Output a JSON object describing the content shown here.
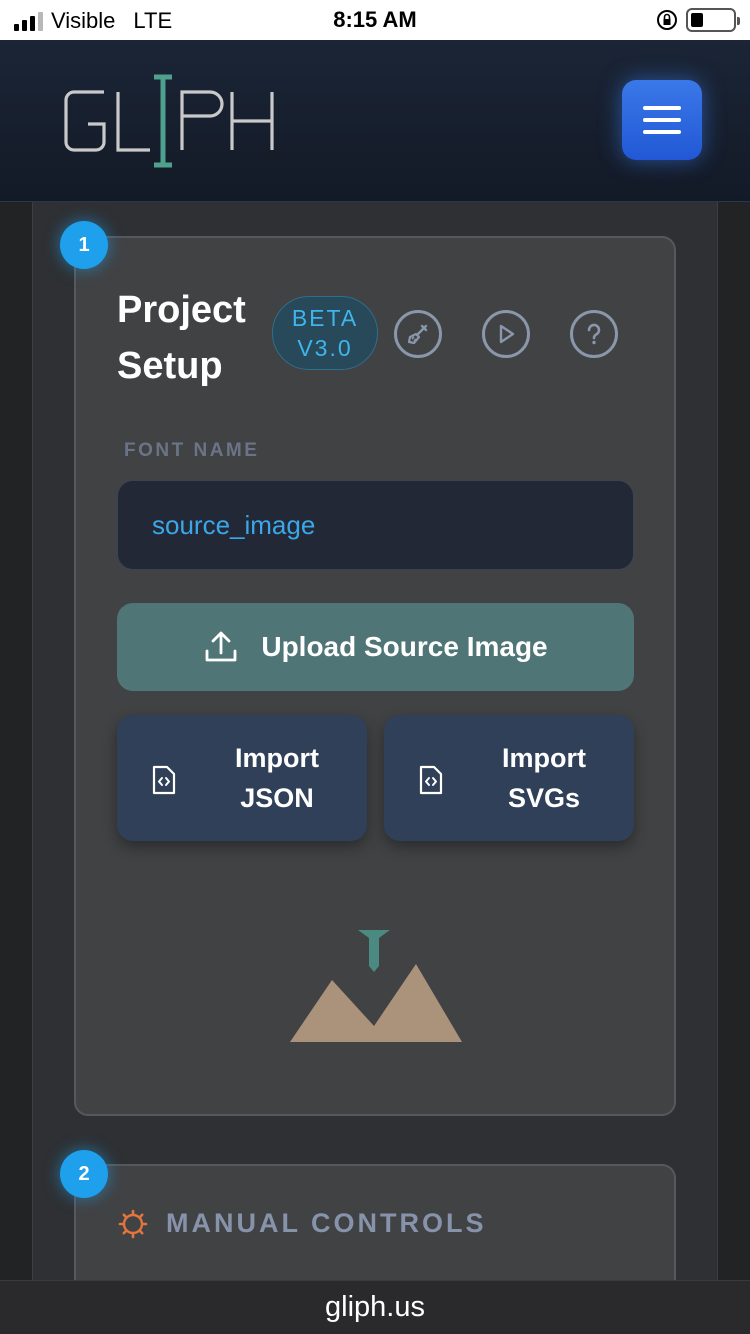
{
  "status_bar": {
    "carrier": "Visible",
    "network": "LTE",
    "time": "8:15 AM",
    "battery_level": 0.3
  },
  "header": {
    "logo_text": "GLIPH",
    "menu_icon": "hamburger-menu-icon",
    "accent_color": "#2f6ee0"
  },
  "steps": {
    "step1": "1",
    "step2": "2"
  },
  "project_setup": {
    "title_line1": "Project",
    "title_line2": "Setup",
    "beta_line1": "BETA",
    "beta_line2": "V3.0",
    "icons": [
      "paintbrush-icon",
      "play-icon",
      "help-icon"
    ],
    "font_name_label": "FONT NAME",
    "font_name_value": "source_image",
    "upload_label": "Upload Source Image",
    "import_json_line1": "Import",
    "import_json_line2": "JSON",
    "import_svg_line1": "Import",
    "import_svg_line2": "SVGs"
  },
  "manual_controls": {
    "label": "MANUAL CONTROLS",
    "icon": "settings-gear-icon"
  },
  "url_bar": {
    "url": "gliph.us"
  }
}
